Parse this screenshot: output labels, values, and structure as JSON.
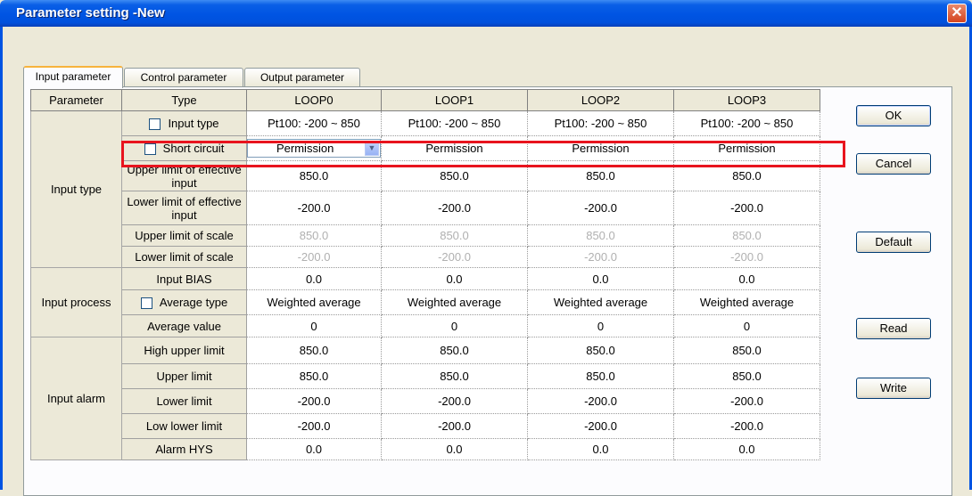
{
  "window": {
    "title": "Parameter setting -New",
    "close_glyph": "✕"
  },
  "tabs": [
    "Input parameter",
    "Control parameter",
    "Output parameter"
  ],
  "table": {
    "headers": [
      "Parameter",
      "Type",
      "LOOP0",
      "LOOP1",
      "LOOP2",
      "LOOP3"
    ],
    "groups": {
      "input_type": "Input type",
      "input_process": "Input process",
      "input_alarm": "Input alarm"
    },
    "rows": [
      {
        "type": "Input type",
        "checkbox": true,
        "values": [
          "Pt100: -200 ~ 850",
          "Pt100: -200 ~ 850",
          "Pt100: -200 ~ 850",
          "Pt100: -200 ~ 850"
        ]
      },
      {
        "type": "Short circuit",
        "checkbox": true,
        "values": [
          "Permission",
          "Permission",
          "Permission",
          "Permission"
        ]
      },
      {
        "type": "Upper limit of effective input",
        "values": [
          "850.0",
          "850.0",
          "850.0",
          "850.0"
        ]
      },
      {
        "type": "Lower limit of effective input",
        "values": [
          "-200.0",
          "-200.0",
          "-200.0",
          "-200.0"
        ]
      },
      {
        "type": "Upper limit of scale",
        "values": [
          "850.0",
          "850.0",
          "850.0",
          "850.0"
        ]
      },
      {
        "type": "Lower limit of scale",
        "values": [
          "-200.0",
          "-200.0",
          "-200.0",
          "-200.0"
        ]
      },
      {
        "type": "Input BIAS",
        "values": [
          "0.0",
          "0.0",
          "0.0",
          "0.0"
        ]
      },
      {
        "type": "Average type",
        "checkbox": true,
        "values": [
          "Weighted average",
          "Weighted average",
          "Weighted average",
          "Weighted average"
        ]
      },
      {
        "type": "Average value",
        "values": [
          "0",
          "0",
          "0",
          "0"
        ]
      },
      {
        "type": "High upper limit",
        "values": [
          "850.0",
          "850.0",
          "850.0",
          "850.0"
        ]
      },
      {
        "type": "Upper limit",
        "values": [
          "850.0",
          "850.0",
          "850.0",
          "850.0"
        ]
      },
      {
        "type": "Lower limit",
        "values": [
          "-200.0",
          "-200.0",
          "-200.0",
          "-200.0"
        ]
      },
      {
        "type": "Low lower limit",
        "values": [
          "-200.0",
          "-200.0",
          "-200.0",
          "-200.0"
        ]
      },
      {
        "type": "Alarm HYS",
        "values": [
          "0.0",
          "0.0",
          "0.0",
          "0.0"
        ]
      }
    ]
  },
  "buttons": {
    "ok": "OK",
    "cancel": "Cancel",
    "default": "Default",
    "read": "Read",
    "write": "Write"
  },
  "highlight_color": "#e8141e"
}
